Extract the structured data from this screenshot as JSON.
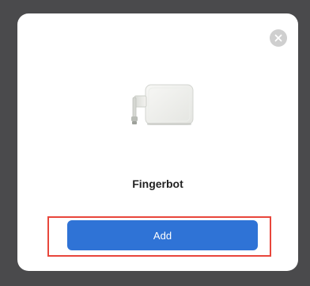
{
  "dialog": {
    "close_icon": "close-icon",
    "device_icon": "fingerbot-device-icon",
    "device_name": "Fingerbot",
    "add_button_label": "Add"
  },
  "colors": {
    "backdrop": "#4a4a4c",
    "dialog_bg": "#ffffff",
    "close_bg": "#cfcfcf",
    "button_bg": "#2f73d6",
    "button_text": "#ffffff",
    "highlight": "#e8463b"
  }
}
